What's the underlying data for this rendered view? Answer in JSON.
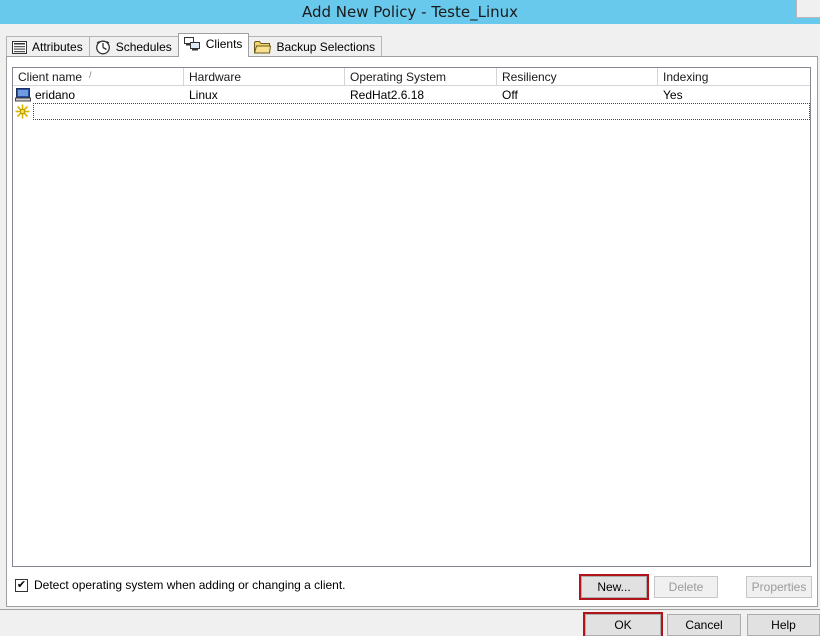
{
  "window": {
    "title": "Add New Policy - Teste_Linux"
  },
  "tabs": [
    {
      "label": "Attributes",
      "icon": "attributes-icon",
      "active": false
    },
    {
      "label": "Schedules",
      "icon": "schedules-icon",
      "active": false
    },
    {
      "label": "Clients",
      "icon": "clients-icon",
      "active": true
    },
    {
      "label": "Backup Selections",
      "icon": "folder-icon",
      "active": false
    }
  ],
  "client_list": {
    "columns": [
      "Client name",
      "Hardware",
      "Operating System",
      "Resiliency",
      "Indexing"
    ],
    "sort_indicator": "/",
    "rows": [
      {
        "client_name": "eridano",
        "hardware": "Linux",
        "operating_system": "RedHat2.6.18",
        "resiliency": "Off",
        "indexing": "Yes"
      }
    ],
    "new_row_icon": "new-entry-icon"
  },
  "options": {
    "detect_os_label": "Detect operating system when adding or changing a client.",
    "detect_os_checked": true,
    "check_mark": "✔"
  },
  "buttons": {
    "new": "New...",
    "delete": "Delete",
    "properties": "Properties",
    "ok": "OK",
    "cancel": "Cancel",
    "help": "Help"
  },
  "colors": {
    "titlebar": "#69c9ec",
    "highlight": "#b0141a"
  }
}
